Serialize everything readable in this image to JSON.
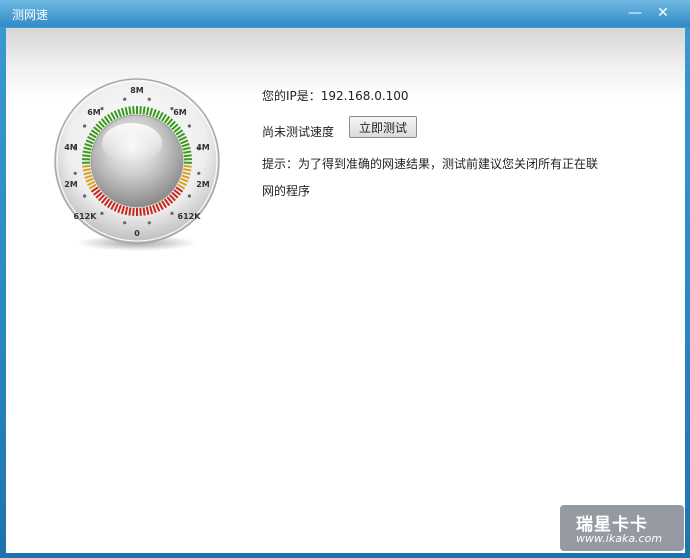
{
  "window": {
    "title": "测网速",
    "minimize_glyph": "—",
    "close_glyph": "✕"
  },
  "gauge": {
    "labels": {
      "top": "8M",
      "upper_left": "6M",
      "upper_right": "6M",
      "mid_left": "4M",
      "mid_right": "4M",
      "lower_left": "2M",
      "lower_right": "2M",
      "bottom_left": "612K",
      "bottom_right": "612K",
      "bottom": "0"
    },
    "level": 0,
    "colors": {
      "high": "#3a9a1c",
      "mid": "#d9a021",
      "low": "#c8281b"
    }
  },
  "main": {
    "ip_line": "您的IP是：192.168.0.100",
    "status_text": "尚未测试速度",
    "test_button": "立即测试",
    "tip": "提示：为了得到准确的网速结果，测试前建议您关闭所有正在联网的程序"
  },
  "watermark": {
    "brand": "瑞星卡卡",
    "url": "www.ikaka.com"
  }
}
